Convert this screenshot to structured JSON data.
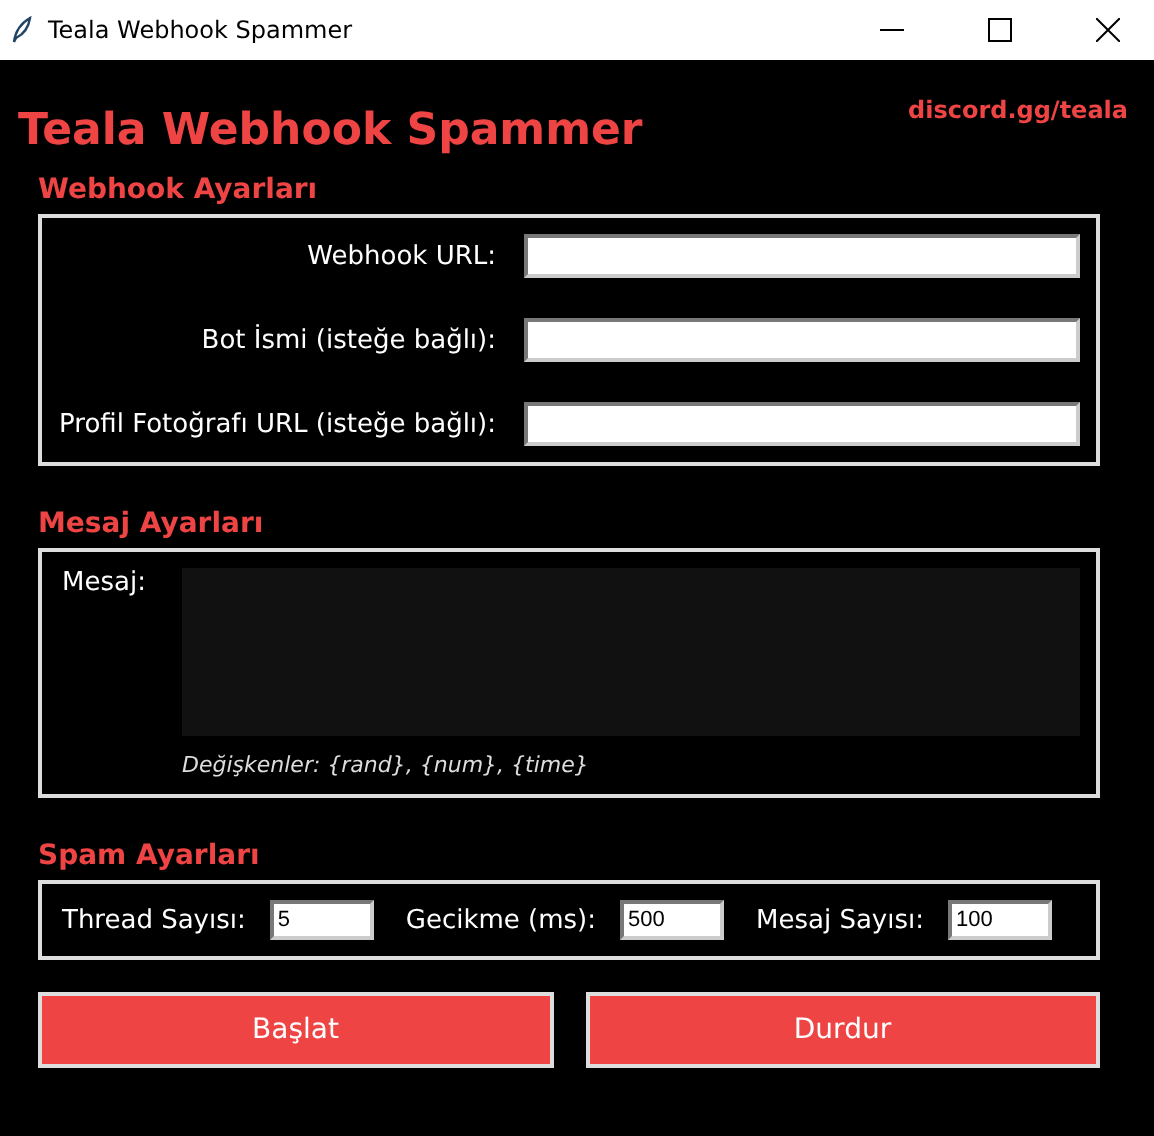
{
  "window": {
    "title": "Teala Webhook Spammer"
  },
  "header": {
    "title": "Teala Webhook Spammer",
    "link": "discord.gg/teala"
  },
  "webhook_settings": {
    "heading": "Webhook Ayarları",
    "fields": [
      {
        "label": "Webhook URL:"
      },
      {
        "label": "Bot İsmi (isteğe bağlı):"
      },
      {
        "label": "Profil Fotoğrafı URL (isteğe bağlı):"
      }
    ]
  },
  "message_settings": {
    "heading": "Mesaj Ayarları",
    "label": "Mesaj:",
    "hint": "Değişkenler: {rand}, {num}, {time}"
  },
  "spam_settings": {
    "heading": "Spam Ayarları",
    "fields": [
      {
        "label": "Thread Sayısı:",
        "value": "5"
      },
      {
        "label": "Gecikme (ms):",
        "value": "500"
      },
      {
        "label": "Mesaj Sayısı:",
        "value": "100"
      }
    ]
  },
  "buttons": [
    "Başlat",
    "Durdur"
  ]
}
